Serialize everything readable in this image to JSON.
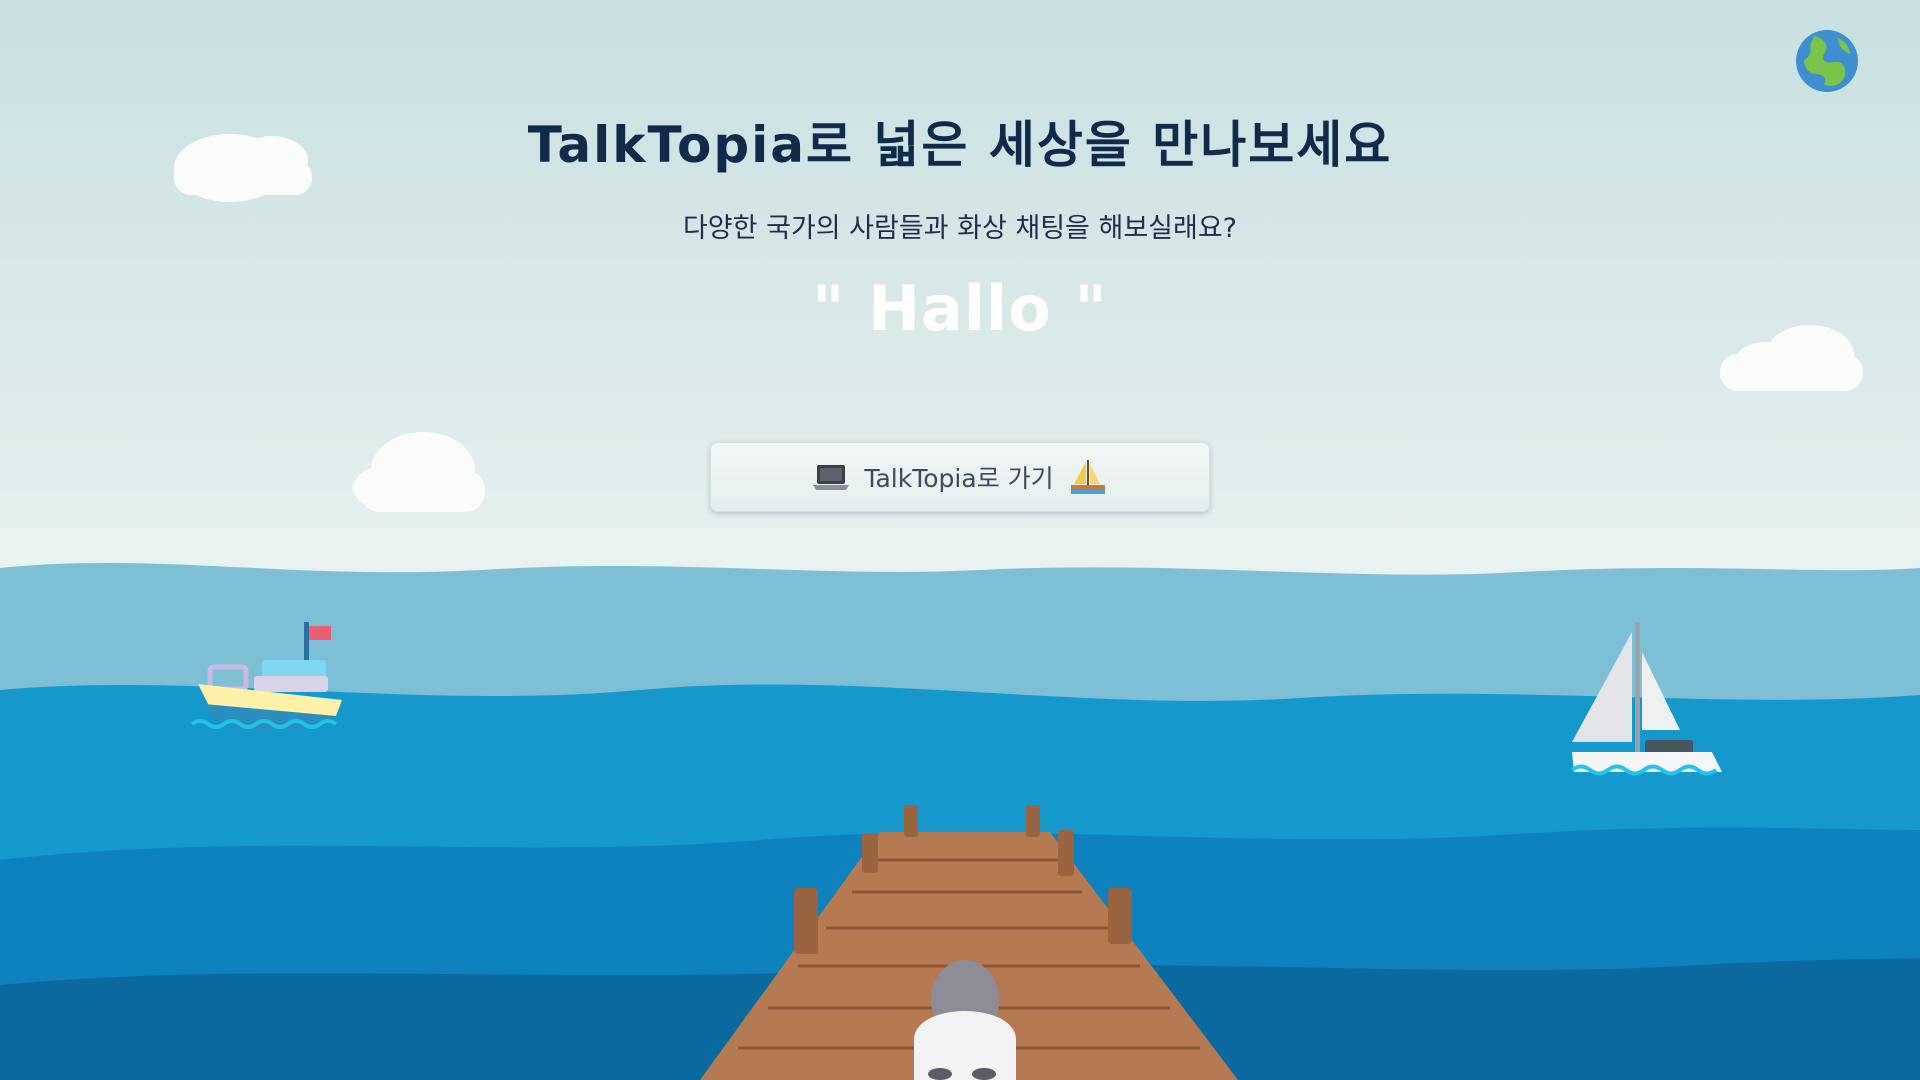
{
  "hero": {
    "title": "TalkTopia로 넓은 세상을 만나보세요",
    "subtitle": "다양한 국가의 사람들과 화상 채팅을 해보실래요?",
    "greeting": "\" Hallo \""
  },
  "cta": {
    "label": "TalkTopia로 가기",
    "left_icon": "laptop-icon",
    "right_icon": "sailboat-icon"
  },
  "header": {
    "globe_icon": "globe-icon"
  },
  "colors": {
    "title": "#0f2a4a",
    "sky_top": "#c7e0e2",
    "sea_light": "#7dbfd4",
    "sea_mid": "#1495c9",
    "sea_deep": "#0a6aa0"
  }
}
